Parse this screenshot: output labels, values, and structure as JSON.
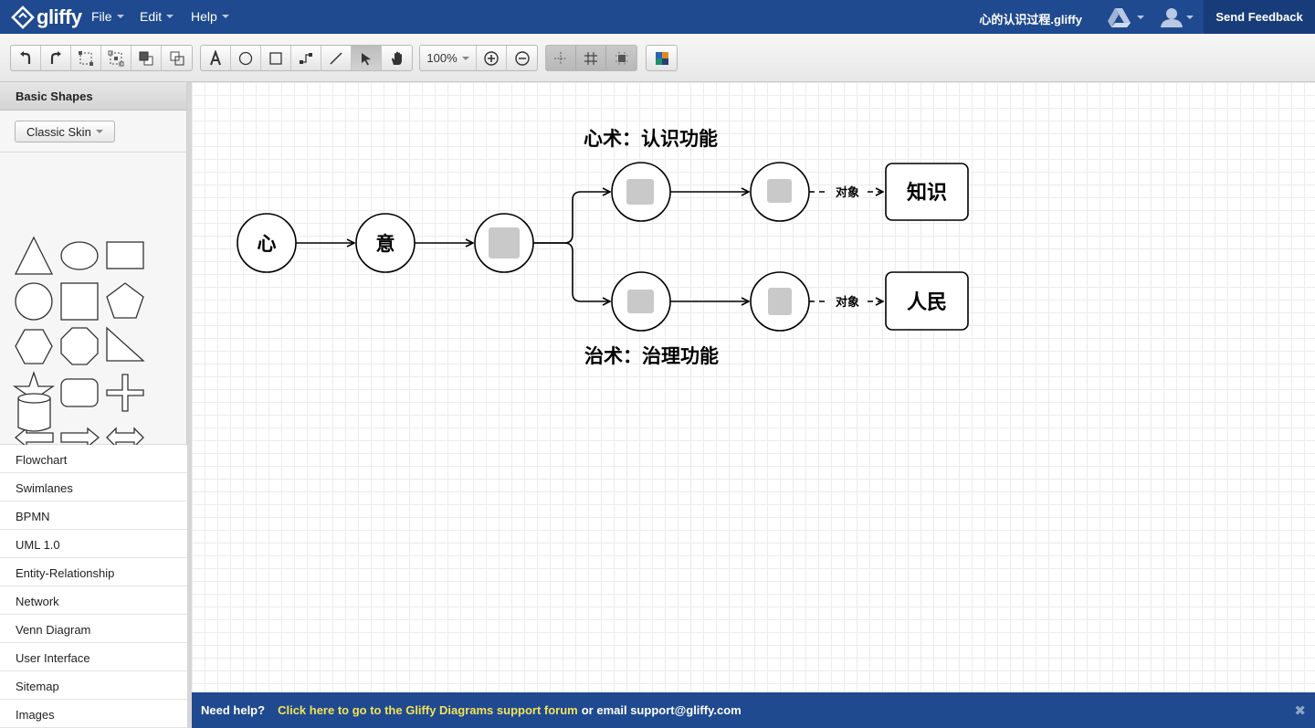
{
  "app": {
    "logo_text": "gliffy"
  },
  "menu": {
    "items": [
      "File",
      "Edit",
      "Help"
    ]
  },
  "header": {
    "doc_title": "心的认识过程.gliffy",
    "feedback_label": "Send Feedback"
  },
  "toolbar": {
    "zoom": "100%"
  },
  "sidebar": {
    "panel_title": "Basic Shapes",
    "skin_label": "Classic Skin",
    "libraries": [
      "Flowchart",
      "Swimlanes",
      "BPMN",
      "UML 1.0",
      "Entity-Relationship",
      "Network",
      "Venn Diagram",
      "User Interface",
      "Sitemap",
      "Images"
    ]
  },
  "diagram": {
    "nodes": {
      "xin": "心",
      "yi": "意",
      "zhishi": "知识",
      "renmin": "人民"
    },
    "top_caption": "心术：认识功能",
    "bottom_caption": "治术：治理功能",
    "edge_label": "对象"
  },
  "helpbar": {
    "prompt": "Need help?",
    "link": "Click here to go to the Gliffy Diagrams support forum",
    "email_text": "or email support@gliffy.com"
  },
  "colors": {
    "brand_blue": "#1f4a8f",
    "feedback_blue": "#173c79",
    "help_link_yellow": "#f2e25a"
  }
}
